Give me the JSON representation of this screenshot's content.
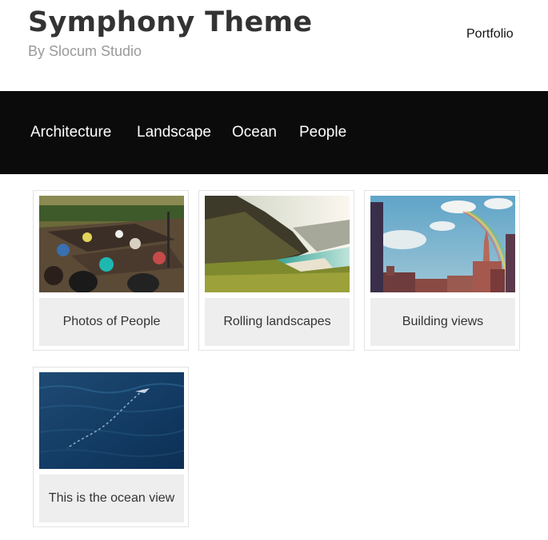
{
  "header": {
    "title": "Symphony Theme",
    "byline": "By Slocum Studio",
    "top_link": "Portfolio"
  },
  "nav": {
    "items": [
      {
        "label": "Architecture"
      },
      {
        "label": "Landscape"
      },
      {
        "label": "Ocean"
      },
      {
        "label": "People"
      }
    ]
  },
  "gallery": {
    "cards": [
      {
        "caption": "Photos of People",
        "image": "market-boats-people-photo"
      },
      {
        "caption": "Rolling landscapes",
        "image": "coastal-mountain-landscape-photo"
      },
      {
        "caption": "Building views",
        "image": "city-skyline-rainbow-photo"
      },
      {
        "caption": "This is the ocean view",
        "image": "deep-blue-ocean-photo"
      }
    ]
  },
  "colors": {
    "nav_background": "#0b0b0b",
    "title_text": "#333333",
    "byline_text": "#9a9a9a",
    "caption_background": "#eeeeee"
  }
}
